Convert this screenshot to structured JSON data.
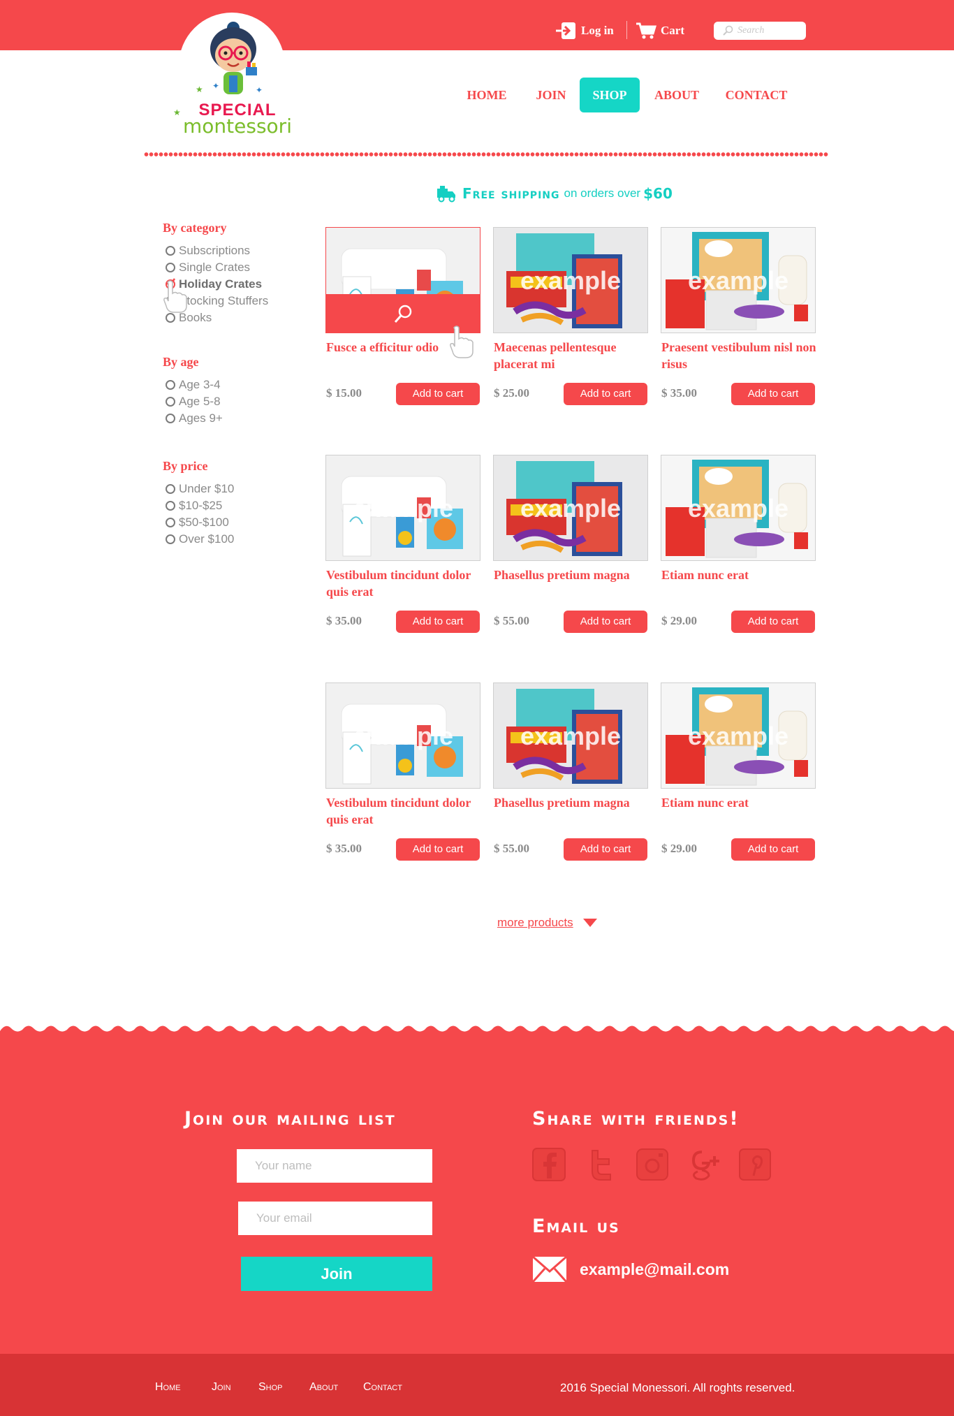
{
  "header": {
    "logo": {
      "line1": "SPECIAL",
      "line2": "montessori"
    },
    "login_label": "Log in",
    "cart_label": "Cart",
    "search_placeholder": "Search",
    "nav": [
      {
        "label": "HOME",
        "active": false
      },
      {
        "label": "JOIN",
        "active": false
      },
      {
        "label": "SHOP",
        "active": true
      },
      {
        "label": "ABOUT",
        "active": false
      },
      {
        "label": "CONTACT",
        "active": false
      }
    ]
  },
  "shipping": {
    "big": "Free shipping",
    "small": "on orders over",
    "amount": "$60"
  },
  "filters": {
    "category": {
      "title": "By category",
      "options": [
        "Subscriptions",
        "Single Crates",
        "Holiday Crates",
        "Stocking Stuffers",
        "Books"
      ],
      "selected": "Holiday Crates"
    },
    "age": {
      "title": "By age",
      "options": [
        "Age 3-4",
        "Age 5-8",
        "Ages 9+"
      ]
    },
    "price": {
      "title": "By price",
      "options": [
        "Under $10",
        "$10-$25",
        "$50-$100",
        "Over $100"
      ]
    }
  },
  "products": [
    {
      "title": "Fusce a efficitur odio",
      "price": "$ 15.00",
      "image": "crate-white",
      "watermark": "example",
      "hovered": true
    },
    {
      "title": "Maecenas pellentesque placerat mi",
      "price": "$ 25.00",
      "image": "crate-finger-paint",
      "watermark": "example"
    },
    {
      "title": "Praesent vestibulum nisl non risus",
      "price": "$ 35.00",
      "image": "crate-wonder-box",
      "watermark": "example"
    },
    {
      "title": "Vestibulum tincidunt dolor quis erat",
      "price": "$ 35.00",
      "image": "crate-white",
      "watermark": "example"
    },
    {
      "title": "Phasellus pretium magna",
      "price": "$ 55.00",
      "image": "crate-finger-paint",
      "watermark": "example"
    },
    {
      "title": "Etiam nunc erat",
      "price": "$ 29.00",
      "image": "crate-wonder-box",
      "watermark": "example"
    },
    {
      "title": "Vestibulum tincidunt dolor quis erat",
      "price": "$ 35.00",
      "image": "crate-white",
      "watermark": "example"
    },
    {
      "title": "Phasellus pretium magna",
      "price": "$ 55.00",
      "image": "crate-finger-paint",
      "watermark": "example"
    },
    {
      "title": "Etiam nunc erat",
      "price": "$ 29.00",
      "image": "crate-wonder-box",
      "watermark": "example"
    }
  ],
  "add_to_cart_label": "Add to cart",
  "more_products_label": "more products",
  "footer": {
    "mailing_title": "Join our mailing list",
    "name_placeholder": "Your name",
    "email_placeholder": "Your email",
    "join_label": "Join",
    "share_title": "Share with friends!",
    "social_icons": [
      "facebook-icon",
      "twitter-icon",
      "instagram-icon",
      "google-plus-icon",
      "pinterest-icon"
    ],
    "email_title": "Email us",
    "email_address": "example@mail.com"
  },
  "bottom": {
    "nav": [
      "Home",
      "Join",
      "Shop",
      "About",
      "Contact"
    ],
    "copyright": "2016 Special Monessori. All roghts reserved."
  },
  "colors": {
    "primary": "#f5484b",
    "accent": "#15d6c6",
    "footer_dark": "#d83335",
    "muted_text": "#8a8a8a"
  }
}
